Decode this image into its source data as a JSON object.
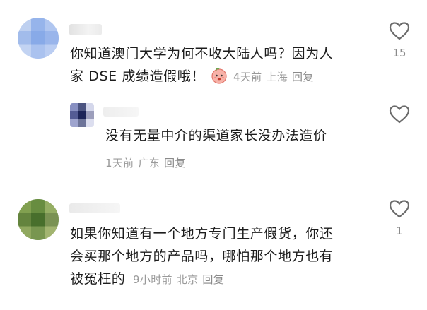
{
  "comments": [
    {
      "text_line1": "你知道澳门大学为何不收大陆人吗？因为人",
      "text_line2": "家 DSE 成绩造假哦！",
      "emoji": "peach-face-emoji",
      "time": "4天前",
      "location": "上海",
      "reply_label": "回复",
      "like_count": "15"
    },
    {
      "text_line1": "没有无量中介的渠道家长没办法造价",
      "time": "1天前",
      "location": "广东",
      "reply_label": "回复",
      "like_count": ""
    },
    {
      "text_line1": "如果你知道有一个地方专门生产假货，你还",
      "text_line2": "会买那个地方的产品吗，哪怕那个地方也有",
      "text_line3": "被冤枉的",
      "time": "9小时前",
      "location": "北京",
      "reply_label": "回复",
      "like_count": "1"
    }
  ],
  "icons": {
    "like": "heart-outline-icon"
  },
  "colors": {
    "text": "#1c1c1c",
    "meta": "#9a9a9a",
    "icon": "#6b6b6b"
  }
}
